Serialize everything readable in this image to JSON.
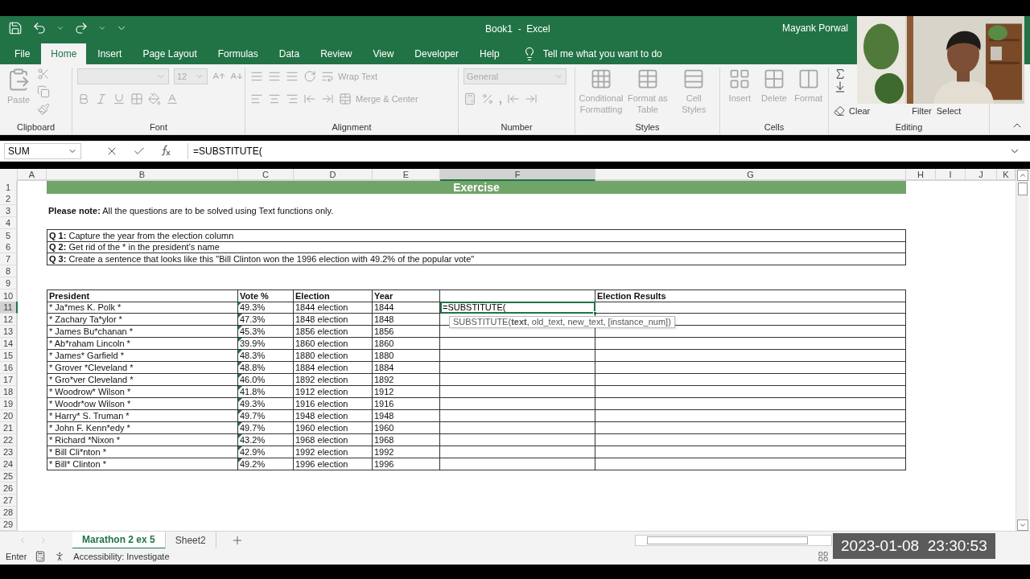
{
  "title_bar": {
    "title": "Book1  -  Excel",
    "user": "Mayank Porwal"
  },
  "menu_tabs": [
    {
      "label": "File",
      "selected": false
    },
    {
      "label": "Home",
      "selected": true
    },
    {
      "label": "Insert",
      "selected": false
    },
    {
      "label": "Page Layout",
      "selected": false
    },
    {
      "label": "Formulas",
      "selected": false
    },
    {
      "label": "Data",
      "selected": false
    },
    {
      "label": "Review",
      "selected": false
    },
    {
      "label": "View",
      "selected": false
    },
    {
      "label": "Developer",
      "selected": false
    },
    {
      "label": "Help",
      "selected": false
    }
  ],
  "tell_me": {
    "placeholder": "Tell me what you want to do"
  },
  "ribbon": {
    "disabled": true,
    "clipboard": {
      "label": "Clipboard",
      "paste": "Paste"
    },
    "font": {
      "label": "Font",
      "size": "12"
    },
    "alignment": {
      "label": "Alignment",
      "wrap_text": "Wrap Text",
      "merge_center": "Merge & Center"
    },
    "number": {
      "label": "Number",
      "format": "General",
      "comma": ","
    },
    "styles": {
      "label": "Styles",
      "buttons": [
        "Conditional Formatting",
        "Format as Table",
        "Cell Styles"
      ]
    },
    "cells": {
      "label": "Cells",
      "buttons": [
        "Insert",
        "Delete",
        "Format"
      ]
    },
    "editing": {
      "label": "Editing",
      "clear": "Clear",
      "filter": "Filter",
      "select": "Select"
    }
  },
  "formula_bar": {
    "name_box": "SUM",
    "formula": "=SUBSTITUTE("
  },
  "columns": [
    {
      "label": "A",
      "selected": false
    },
    {
      "label": "B",
      "selected": false
    },
    {
      "label": "C",
      "selected": false
    },
    {
      "label": "D",
      "selected": false
    },
    {
      "label": "E",
      "selected": false
    },
    {
      "label": "F",
      "selected": true
    },
    {
      "label": "G",
      "selected": false
    },
    {
      "label": "H",
      "selected": false
    },
    {
      "label": "I",
      "selected": false
    },
    {
      "label": "J",
      "selected": false
    },
    {
      "label": "K",
      "selected": false
    }
  ],
  "row_headers": [
    {
      "label": "1",
      "selected": false
    },
    {
      "label": "2",
      "selected": false
    },
    {
      "label": "3",
      "selected": false
    },
    {
      "label": "4",
      "selected": false
    },
    {
      "label": "5",
      "selected": false
    },
    {
      "label": "6",
      "selected": false
    },
    {
      "label": "7",
      "selected": false
    },
    {
      "label": "8",
      "selected": false
    },
    {
      "label": "9",
      "selected": false
    },
    {
      "label": "10",
      "selected": false
    },
    {
      "label": "11",
      "selected": true
    },
    {
      "label": "12",
      "selected": false
    },
    {
      "label": "13",
      "selected": false
    },
    {
      "label": "14",
      "selected": false
    },
    {
      "label": "15",
      "selected": false
    },
    {
      "label": "16",
      "selected": false
    },
    {
      "label": "17",
      "selected": false
    },
    {
      "label": "18",
      "selected": false
    },
    {
      "label": "19",
      "selected": false
    },
    {
      "label": "20",
      "selected": false
    },
    {
      "label": "21",
      "selected": false
    },
    {
      "label": "22",
      "selected": false
    },
    {
      "label": "23",
      "selected": false
    },
    {
      "label": "24",
      "selected": false
    },
    {
      "label": "25",
      "selected": false
    },
    {
      "label": "26",
      "selected": false
    },
    {
      "label": "27",
      "selected": false
    },
    {
      "label": "28",
      "selected": false
    },
    {
      "label": "29",
      "selected": false
    }
  ],
  "sheet": {
    "banner": "Exercise",
    "note": "**Please note:** All the questions are to be solved using Text functions only.",
    "questions": [
      "**Q 1:** Capture the year from the election column",
      "**Q 2:** Get rid of the * in the president's name",
      "**Q 3:** Create a sentence that looks like this \"Bill Clinton won the 1996 election with 49.2% of the popular vote\""
    ],
    "table": {
      "headers": [
        "President",
        "Vote %",
        "Election",
        "Year"
      ],
      "results_header": "Election Results",
      "rows": [
        {
          "president": "* Ja*mes K. Polk *",
          "vote": "49.3%",
          "election": "1844 election",
          "year": "1844",
          "f_cell": {
            "formula": "=SUBSTITUTE(",
            "tooltip": "SUBSTITUTE(**text**, old_text, new_text, [instance_num])"
          }
        },
        {
          "president": "* Zachary Ta*ylor *",
          "vote": "47.3%",
          "election": "1848 election",
          "year": "1848"
        },
        {
          "president": "* James Bu*chanan *",
          "vote": "45.3%",
          "election": "1856 election",
          "year": "1856"
        },
        {
          "president": "* Ab*raham Lincoln *",
          "vote": "39.9%",
          "election": "1860 election",
          "year": "1860"
        },
        {
          "president": "* James* Garfield *",
          "vote": "48.3%",
          "election": "1880 election",
          "year": "1880"
        },
        {
          "president": "* Grover *Cleveland *",
          "vote": "48.8%",
          "election": "1884 election",
          "year": "1884"
        },
        {
          "president": "* Gro*ver Cleveland *",
          "vote": "46.0%",
          "election": "1892 election",
          "year": "1892"
        },
        {
          "president": "* Woodrow* Wilson *",
          "vote": "41.8%",
          "election": "1912 election",
          "year": "1912"
        },
        {
          "president": "* Woodr*ow Wilson *",
          "vote": "49.3%",
          "election": "1916 election",
          "year": "1916"
        },
        {
          "president": "* Harry* S. Truman *",
          "vote": "49.7%",
          "election": "1948 election",
          "year": "1948"
        },
        {
          "president": "* John F. Kenn*edy *",
          "vote": "49.7%",
          "election": "1960 election",
          "year": "1960"
        },
        {
          "president": "* Richard *Nixon *",
          "vote": "43.2%",
          "election": "1968 election",
          "year": "1968"
        },
        {
          "president": "* Bill Cli*nton *",
          "vote": "42.9%",
          "election": "1992 election",
          "year": "1992"
        },
        {
          "president": "* Bill* Clinton *",
          "vote": "49.2%",
          "election": "1996 election",
          "year": "1996"
        }
      ]
    }
  },
  "sheet_tabs": [
    {
      "label": "Marathon 2 ex 5",
      "selected": true
    },
    {
      "label": "Sheet2",
      "selected": false
    }
  ],
  "status_bar": {
    "mode": "Enter",
    "accessibility": "Accessibility: Investigate"
  },
  "timestamp": "2023-01-08  23:30:53"
}
